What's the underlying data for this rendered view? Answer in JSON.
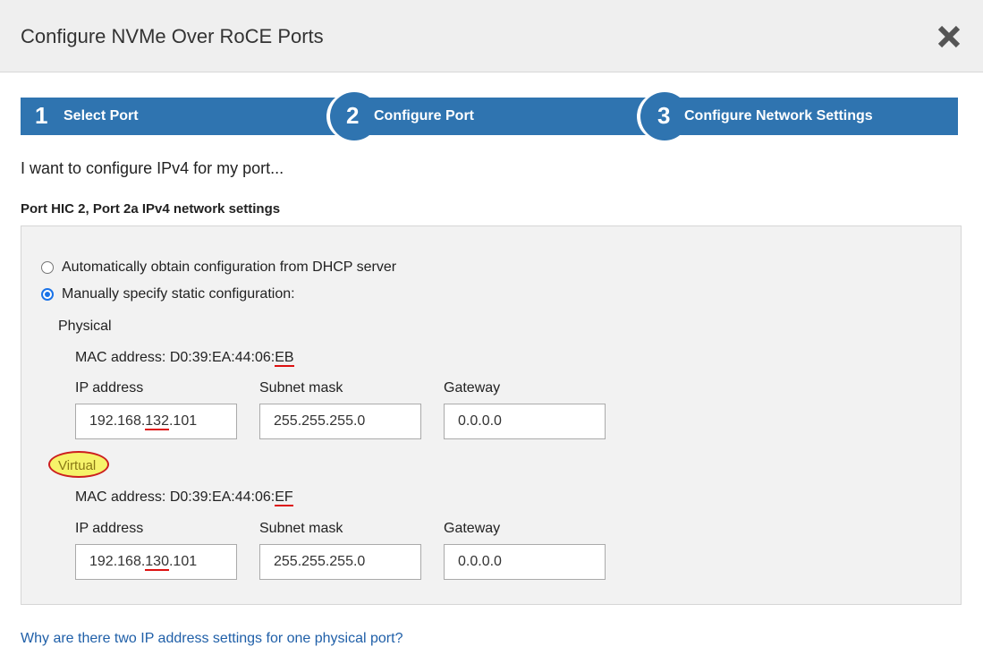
{
  "dialog": {
    "title": "Configure NVMe Over RoCE Ports",
    "close_icon": "close-icon"
  },
  "steps": [
    {
      "number": "1",
      "label": "Select Port"
    },
    {
      "number": "2",
      "label": "Configure Port"
    },
    {
      "number": "3",
      "label": "Configure Network Settings"
    }
  ],
  "intro": "I want to configure IPv4 for my port...",
  "section_title": "Port HIC 2, Port 2a IPv4 network settings",
  "options": {
    "dhcp_label": "Automatically obtain configuration from DHCP server",
    "static_label": "Manually specify static configuration:",
    "selected": "static"
  },
  "physical": {
    "heading": "Physical",
    "mac_prefix": "MAC address: D0:39:EA:44:06:",
    "mac_suffix": "EB",
    "ip_label": "IP address",
    "subnet_label": "Subnet mask",
    "gateway_label": "Gateway",
    "ip_a": "192.168.",
    "ip_b": "132",
    "ip_c": ".101",
    "subnet": "255.255.255.0",
    "gateway": "0.0.0.0"
  },
  "virtual": {
    "heading": "Virtual",
    "mac_prefix": "MAC address: D0:39:EA:44:06:",
    "mac_suffix": "EF",
    "ip_label": "IP address",
    "subnet_label": "Subnet mask",
    "gateway_label": "Gateway",
    "ip_a": "192.168.",
    "ip_b": "130",
    "ip_c": ".101",
    "subnet": "255.255.255.0",
    "gateway": "0.0.0.0"
  },
  "help_link": "Why are there two IP address settings for one physical port?",
  "colors": {
    "step_bar": "#2f74b0",
    "link": "#1f5fa8",
    "radio_selected": "#1a73e8",
    "annotation_outline": "#cc1f1f",
    "annotation_highlight": "#f6f36a"
  }
}
